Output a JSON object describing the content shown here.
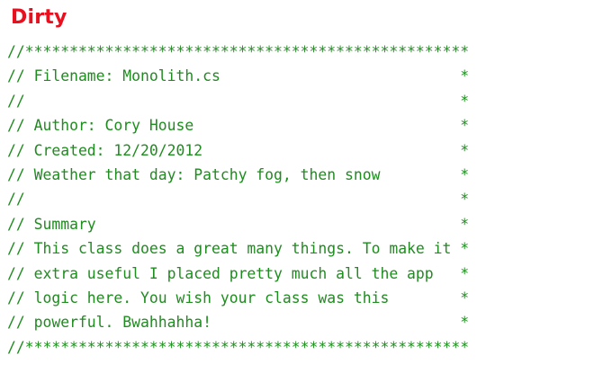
{
  "heading": "Dirty",
  "code_lines": [
    "//**************************************************",
    "// Filename: Monolith.cs                           *",
    "//                                                 *",
    "// Author: Cory House                              *",
    "// Created: 12/20/2012                             *",
    "// Weather that day: Patchy fog, then snow         *",
    "//                                                 *",
    "// Summary                                         *",
    "// This class does a great many things. To make it *",
    "// extra useful I placed pretty much all the app   *",
    "// logic here. You wish your class was this        *",
    "// powerful. Bwahhahha!                            *",
    "//**************************************************"
  ],
  "colors": {
    "heading": "#e8101e",
    "code_comment": "#1e8c1e",
    "background": "#ffffff"
  }
}
